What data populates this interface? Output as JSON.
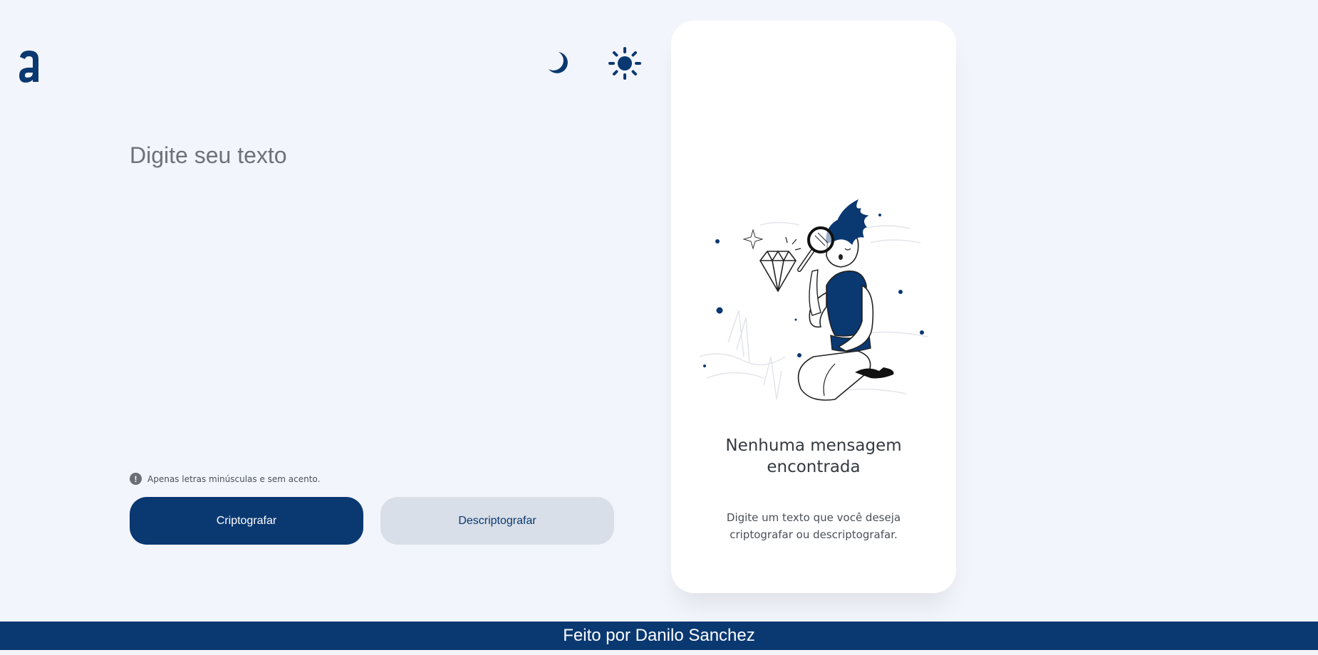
{
  "app": {
    "logo_letter": "a",
    "theme": {
      "dark_icon": "moon-icon",
      "light_icon": "sun-icon"
    }
  },
  "input": {
    "placeholder": "Digite seu texto",
    "value": ""
  },
  "hint": {
    "icon": "info-icon",
    "text": "Apenas letras minúsculas e sem acento."
  },
  "buttons": {
    "encrypt_label": "Criptografar",
    "decrypt_label": "Descriptografar"
  },
  "output": {
    "illustration": "person-with-magnifier-and-diamond-illustration",
    "title": "Nenhuma mensagem encontrada",
    "description": "Digite um texto que você deseja criptografar ou descriptografar."
  },
  "footer": {
    "text": "Feito por Danilo Sanchez"
  },
  "colors": {
    "primary": "#0a3871",
    "background": "#f3f5fc",
    "secondary_button": "#d8dfe8",
    "panel": "#ffffff",
    "text_muted": "#495057"
  }
}
